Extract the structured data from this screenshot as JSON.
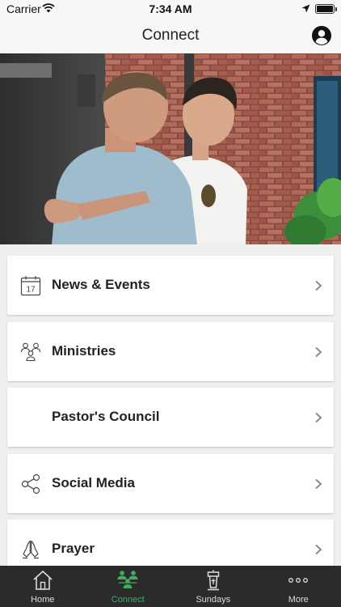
{
  "status_bar": {
    "carrier": "Carrier",
    "time": "7:34 AM"
  },
  "nav": {
    "title": "Connect",
    "profile_icon": "person-circle-icon"
  },
  "hero": {
    "description_icon": "photo"
  },
  "menu": {
    "items": [
      {
        "label": "News & Events",
        "icon": "calendar-icon",
        "calendar_day": "17"
      },
      {
        "label": "Ministries",
        "icon": "people-group-icon"
      },
      {
        "label": "Pastor's Council",
        "icon": ""
      },
      {
        "label": "Social Media",
        "icon": "share-icon"
      },
      {
        "label": "Prayer",
        "icon": "praying-hands-icon"
      }
    ]
  },
  "tabs": [
    {
      "label": "Home",
      "icon": "home-icon",
      "active": false
    },
    {
      "label": "Connect",
      "icon": "connect-icon",
      "active": true
    },
    {
      "label": "Sundays",
      "icon": "pulpit-icon",
      "active": false
    },
    {
      "label": "More",
      "icon": "ellipsis-icon",
      "active": false
    }
  ],
  "colors": {
    "accent": "#3fae5c",
    "tab_bar_bg": "#2b2b2b",
    "nav_bg": "#f7f7f7",
    "list_bg": "#efefef"
  }
}
